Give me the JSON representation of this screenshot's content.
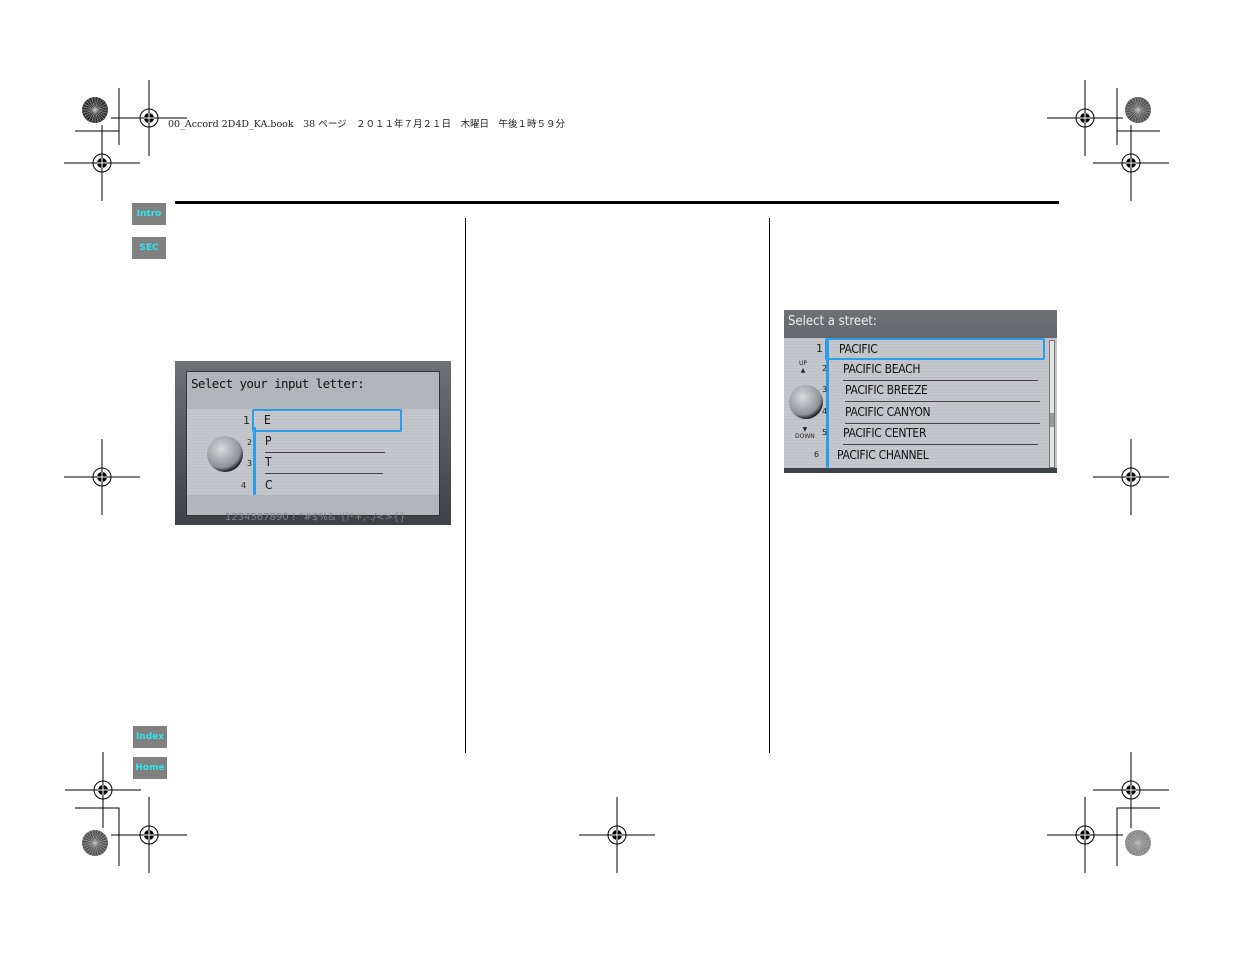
{
  "header_line": "00_Accord 2D4D_KA.book　38 ページ　２０１１年７月２１日　木曜日　午後１時５９分",
  "nav": {
    "intro": "Intro",
    "sec": "SEC",
    "index": "Index",
    "home": "Home"
  },
  "colors": {
    "nav_bg": "#808080",
    "nav_text": "#2ee6f0",
    "highlight": "#2a9ee8"
  },
  "letter_screen": {
    "title": "Select your input letter:",
    "items": [
      {
        "num": "1",
        "label": "E",
        "selected": true
      },
      {
        "num": "2",
        "label": "P"
      },
      {
        "num": "3",
        "label": "T"
      },
      {
        "num": "4",
        "label": "C"
      }
    ],
    "footer": "1234567890 ! \"#$%& '()*+,-./<>{}"
  },
  "street_screen": {
    "title": "Select a street:",
    "up": "UP",
    "down": "DOWN",
    "items": [
      {
        "num": "1",
        "label": "PACIFIC",
        "selected": true
      },
      {
        "num": "2",
        "label": "PACIFIC BEACH"
      },
      {
        "num": "3",
        "label": "PACIFIC BREEZE"
      },
      {
        "num": "4",
        "label": "PACIFIC CANYON"
      },
      {
        "num": "5",
        "label": "PACIFIC CENTER"
      },
      {
        "num": "6",
        "label": "PACIFIC CHANNEL"
      }
    ],
    "scroll_position": 0.7
  }
}
